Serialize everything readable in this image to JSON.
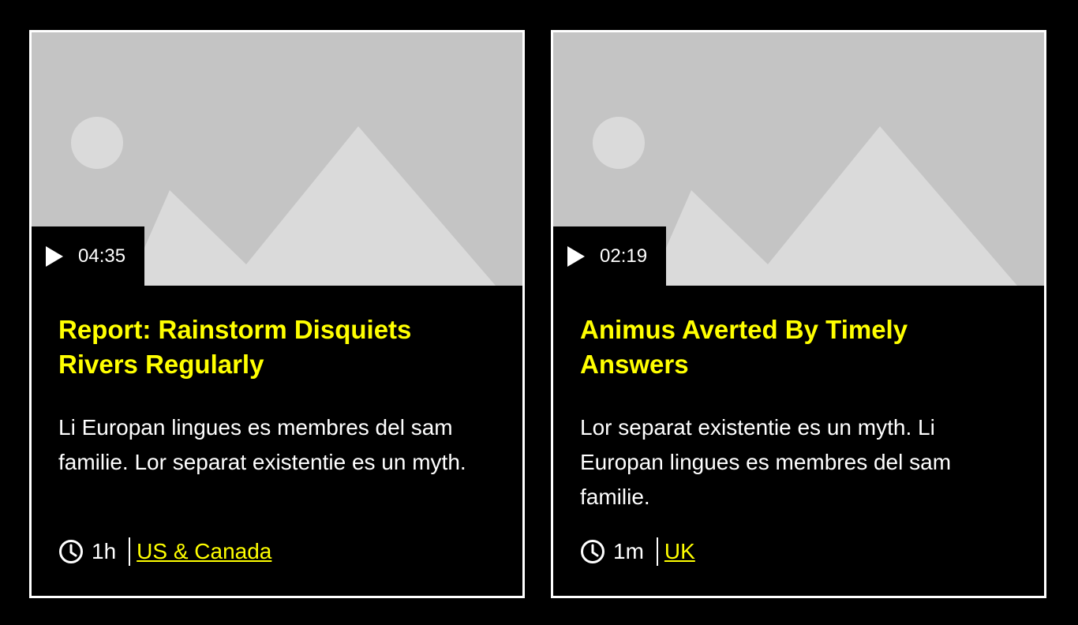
{
  "cards": [
    {
      "duration": "04:35",
      "title": "Report: Rainstorm Disquiets Rivers Regularly",
      "description": "Li Europan lingues es membres del sam familie. Lor separat existentie es un myth.",
      "age": "1h",
      "region": "US & Canada"
    },
    {
      "duration": "02:19",
      "title": "Animus Averted By Timely Answers",
      "description": "Lor separat existentie es un myth. Li Europan lingues es membres del sam familie.",
      "age": "1m",
      "region": "UK"
    }
  ],
  "icons": {
    "play": "play-icon",
    "clock": "clock-icon",
    "image_placeholder": "image-placeholder-icon"
  },
  "colors": {
    "background": "#000000",
    "border": "#ffffff",
    "title": "#ffff00",
    "link": "#ffff00",
    "text": "#ffffff",
    "placeholder_bg": "#c4c4c4",
    "placeholder_shape": "#dadada"
  }
}
